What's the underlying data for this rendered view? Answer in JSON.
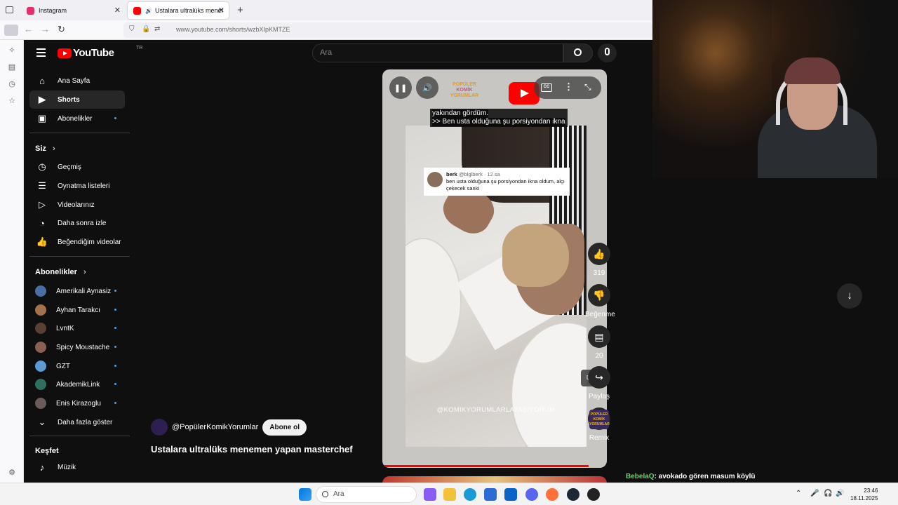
{
  "browser": {
    "tabs": [
      {
        "title": "Instagram",
        "favicon_color": "#e1306c"
      },
      {
        "title": "Ustalara ultralüks menemen",
        "favicon_color": "#ff0000"
      }
    ],
    "new_tab": "+",
    "url": "www.youtube.com/shorts/wzbXIpKMTZE"
  },
  "youtube": {
    "logo": "YouTube",
    "region": "TR",
    "search_placeholder": "Ara",
    "nav": [
      {
        "label": "Ana Sayfa",
        "icon": "home-icon"
      },
      {
        "label": "Shorts",
        "icon": "shorts-icon"
      },
      {
        "label": "Abonelikler",
        "icon": "subscriptions-icon"
      }
    ],
    "you_section": "Siz",
    "you_items": [
      {
        "label": "Geçmiş",
        "icon": "history-icon"
      },
      {
        "label": "Oynatma listeleri",
        "icon": "playlist-icon"
      },
      {
        "label": "Videolarınız",
        "icon": "your-videos-icon"
      },
      {
        "label": "Daha sonra izle",
        "icon": "watch-later-icon"
      },
      {
        "label": "Beğendiğim videolar",
        "icon": "liked-icon"
      }
    ],
    "subs_section": "Abonelikler",
    "subscriptions": [
      {
        "name": "Amerikali Aynasiz",
        "color": "#4a6fa5"
      },
      {
        "name": "Ayhan Tarakcı",
        "color": "#a5714a"
      },
      {
        "name": "LvntK",
        "color": "#5a4030"
      },
      {
        "name": "Spicy Moustache",
        "color": "#8a6050"
      },
      {
        "name": "GZT",
        "color": "#5b9bd5"
      },
      {
        "name": "AkademikLink",
        "color": "#2f6f5f"
      },
      {
        "name": "Enis Kirazoglu",
        "color": "#6a5a5a"
      }
    ],
    "show_more": "Daha fazla göster",
    "explore_section": "Keşfet",
    "explore_items": [
      {
        "label": "Müzik",
        "icon": "music-icon"
      }
    ],
    "short": {
      "captions": [
        "yakından gördüm.",
        ">> Ben usta olduğuna şu porsiyondan ikna"
      ],
      "channel_logo": [
        "POPÜLER",
        "KOMİK",
        "YORUMLAR"
      ],
      "tweet": {
        "name": "berk",
        "handle": "@blglberk · 12 sa",
        "text": "ben usta olduğuna şu porsiyondan ikna oldum, alçı çekecek sanki"
      },
      "watermark": "@KOMIKYORUMLARLAYAŞIYORUM",
      "channel": "@PopülerKomikYorumlar",
      "subscribe": "Abone ol",
      "title": "Ustalara ultralüks menemen yapan masterchef",
      "progress": 0.92
    },
    "actions": {
      "likes": "319",
      "dislike": "Beğenme",
      "comments": "20",
      "share": "Paylaş",
      "remix": "Remix"
    }
  },
  "chat": {
    "user": "BebelaQ",
    "message": ": avokado gören masum köylü"
  },
  "taskbar": {
    "search": "Ara",
    "time": "23:46",
    "date": "18.11.2025"
  }
}
